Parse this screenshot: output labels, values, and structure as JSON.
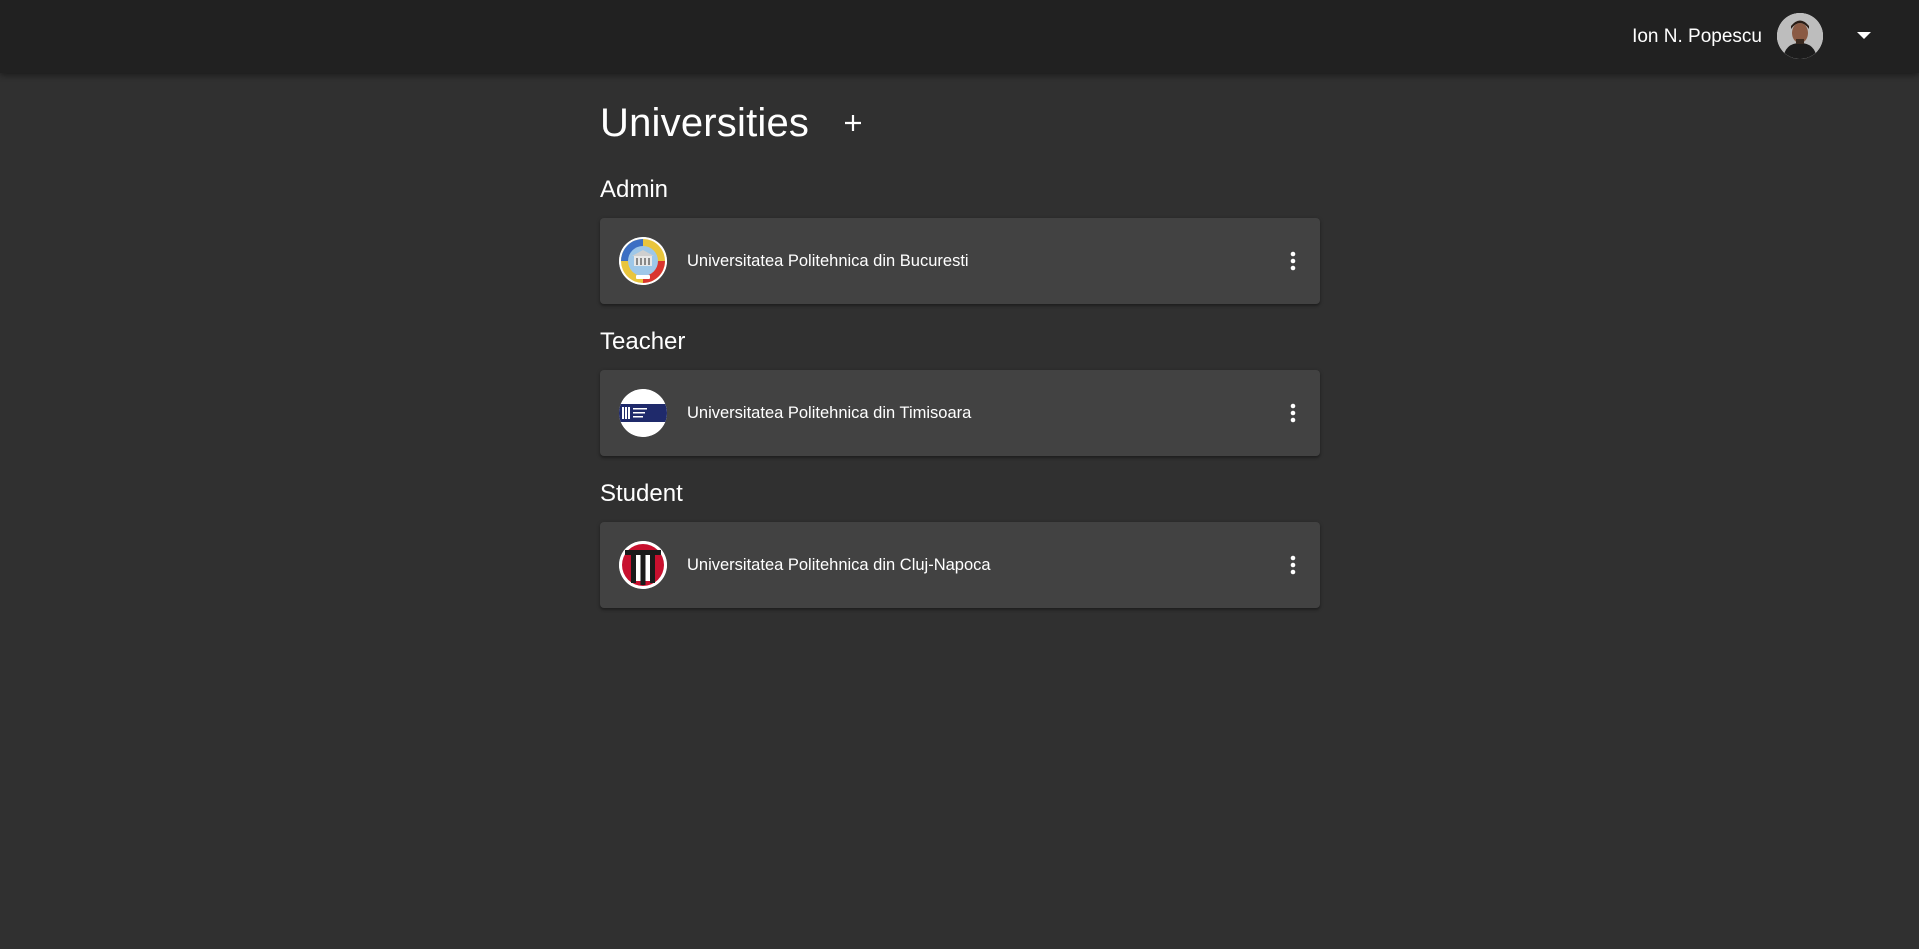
{
  "header": {
    "user_name": "Ion N. Popescu"
  },
  "page": {
    "title": "Universities"
  },
  "sections": [
    {
      "title": "Admin",
      "universities": [
        {
          "name": "Universitatea Politehnica din Bucuresti",
          "logo": "upb-logo"
        }
      ]
    },
    {
      "title": "Teacher",
      "universities": [
        {
          "name": "Universitatea Politehnica din Timisoara",
          "logo": "upt-logo"
        }
      ]
    },
    {
      "title": "Student",
      "universities": [
        {
          "name": "Universitatea Politehnica din Cluj-Napoca",
          "logo": "utcn-logo"
        }
      ]
    }
  ],
  "icons": {
    "add": "plus-icon",
    "more": "more-vert-icon",
    "dropdown": "arrow-drop-down-icon"
  },
  "colors": {
    "background": "#303030",
    "topbar": "#212121",
    "card": "#424242",
    "text": "#ffffff"
  }
}
